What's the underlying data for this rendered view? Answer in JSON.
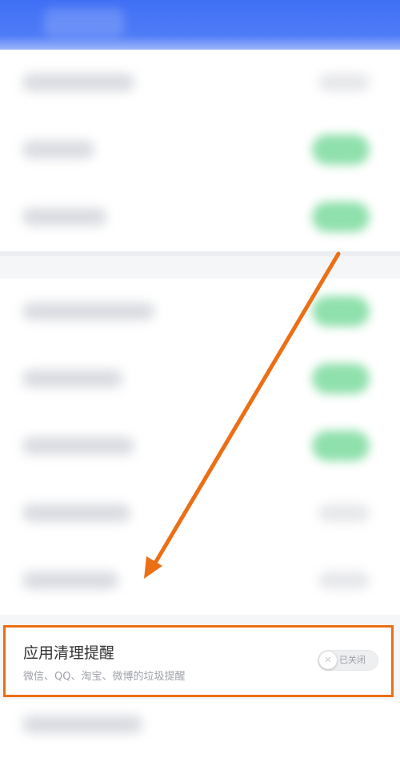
{
  "setting": {
    "title": "应用清理提醒",
    "subtitle": "微信、QQ、淘宝、微博的垃圾提醒",
    "toggle_state": "已关闭",
    "toggle_icon": "close-x-icon"
  },
  "colors": {
    "header_blue": "#3f6ff5",
    "highlight_orange": "#ec6e15",
    "toggle_on_green": "#8fe0ac"
  }
}
